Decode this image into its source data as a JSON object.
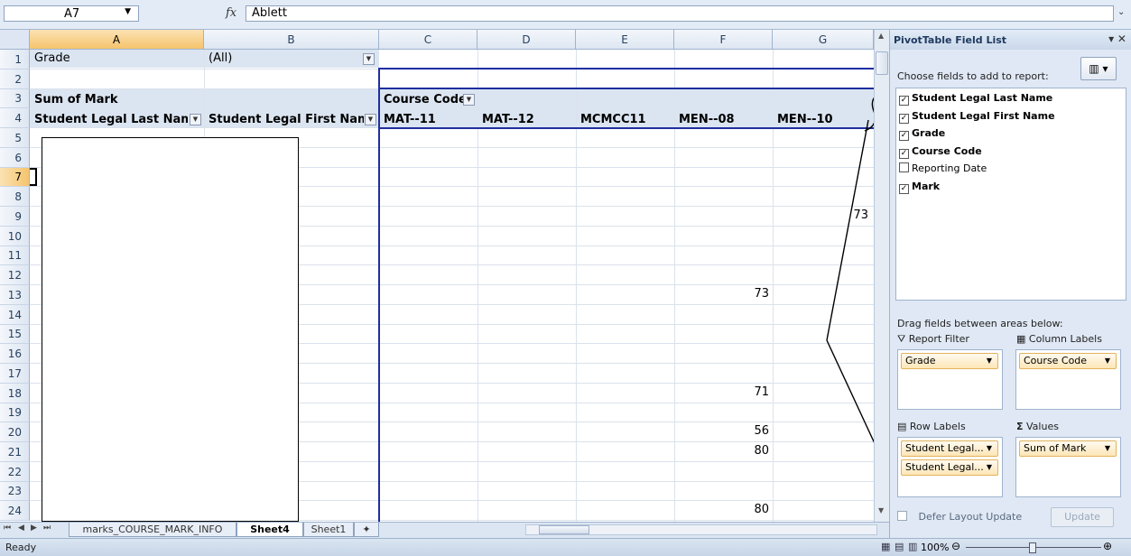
{
  "formula_bar": {
    "name_box": "A7",
    "fx": "fx",
    "formula": "Ablett"
  },
  "columns": [
    "A",
    "B",
    "C",
    "D",
    "E",
    "F",
    "G"
  ],
  "rows": [
    "1",
    "2",
    "3",
    "4",
    "5",
    "6",
    "7",
    "8",
    "9",
    "10",
    "11",
    "12",
    "13",
    "14",
    "15",
    "16",
    "17",
    "18",
    "19",
    "20",
    "21",
    "22",
    "23",
    "24"
  ],
  "pivot": {
    "filter_label": "Grade",
    "filter_value": "(All)",
    "sum_label": "Sum of Mark",
    "course_code_label": "Course Code",
    "row_header_1": "Student Legal Last Name",
    "row_header_2": "Student Legal First Name",
    "course_codes": [
      "MAT--11",
      "MAT--12",
      "MCMCC11",
      "MEN--08",
      "MEN--10"
    ],
    "values": [
      {
        "row": "9",
        "col": "G",
        "value": "73"
      },
      {
        "row": "13",
        "col": "F",
        "value": "73"
      },
      {
        "row": "18",
        "col": "F",
        "value": "71"
      },
      {
        "row": "20",
        "col": "F",
        "value": "56"
      },
      {
        "row": "21",
        "col": "F",
        "value": "80"
      },
      {
        "row": "24",
        "col": "F",
        "value": "80"
      }
    ]
  },
  "sheet_tabs": [
    "marks_COURSE_MARK_INFO",
    "Sheet4",
    "Sheet1"
  ],
  "active_tab": "Sheet4",
  "status": {
    "text": "Ready",
    "zoom": "100%"
  },
  "field_list": {
    "title": "PivotTable Field List",
    "choose_label": "Choose fields to add to report:",
    "fields": [
      {
        "name": "Student Legal Last Name",
        "checked": true
      },
      {
        "name": "Student Legal First Name",
        "checked": true
      },
      {
        "name": "Grade",
        "checked": true
      },
      {
        "name": "Course Code",
        "checked": true
      },
      {
        "name": "Reporting Date",
        "checked": false
      },
      {
        "name": "Mark",
        "checked": true
      }
    ],
    "drag_label": "Drag fields between areas below:",
    "areas": {
      "report_filter": {
        "label": "Report Filter",
        "items": [
          "Grade"
        ]
      },
      "column_labels": {
        "label": "Column Labels",
        "items": [
          "Course Code"
        ]
      },
      "row_labels": {
        "label": "Row Labels",
        "items": [
          "Student Legal...",
          "Student Legal..."
        ]
      },
      "values": {
        "label": "Values",
        "items": [
          "Sum of Mark"
        ]
      }
    },
    "defer_label": "Defer Layout Update",
    "update_label": "Update"
  }
}
